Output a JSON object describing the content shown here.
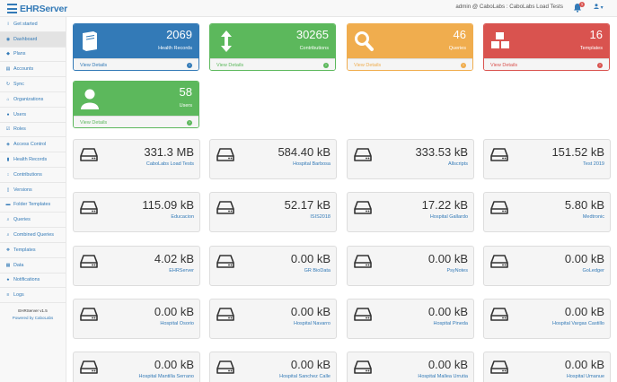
{
  "app": {
    "title": "EHRServer",
    "user_info": "admin @ CaboLabs : CaboLabs Load Tests",
    "notification_count": "1",
    "user_caret": "▾"
  },
  "sidebar": {
    "items": [
      {
        "label": "Get started",
        "icon": "info-icon"
      },
      {
        "label": "Dashboard",
        "icon": "dashboard-icon"
      },
      {
        "label": "Plans",
        "icon": "plans-icon"
      },
      {
        "label": "Accounts",
        "icon": "accounts-icon"
      },
      {
        "label": "Sync",
        "icon": "sync-icon"
      },
      {
        "label": "Organizations",
        "icon": "organizations-icon"
      },
      {
        "label": "Users",
        "icon": "user-icon"
      },
      {
        "label": "Roles",
        "icon": "roles-icon"
      },
      {
        "label": "Access Control",
        "icon": "shield-icon"
      },
      {
        "label": "Health Records",
        "icon": "health-records-icon"
      },
      {
        "label": "Contributions",
        "icon": "contributions-icon"
      },
      {
        "label": "Versions",
        "icon": "versions-icon"
      },
      {
        "label": "Folder Templates",
        "icon": "folder-icon"
      },
      {
        "label": "Queries",
        "icon": "search-icon"
      },
      {
        "label": "Combined Queries",
        "icon": "search-icon"
      },
      {
        "label": "Templates",
        "icon": "templates-icon"
      },
      {
        "label": "Data",
        "icon": "data-icon"
      },
      {
        "label": "Notifications",
        "icon": "bell-icon"
      },
      {
        "label": "Logs",
        "icon": "logs-icon"
      }
    ],
    "version": "EHRServer v1.5",
    "powered_by": "Powered by CaboLabs"
  },
  "panels": [
    {
      "count": "2069",
      "label": "Health Records",
      "link": "View Details",
      "color": "#337ab7",
      "icon": "book-icon"
    },
    {
      "count": "30265",
      "label": "Contributions",
      "link": "View Details",
      "color": "#5cb85c",
      "icon": "arrows-vertical-icon"
    },
    {
      "count": "46",
      "label": "Queries",
      "link": "View Details",
      "color": "#f0ad4e",
      "icon": "search-icon"
    },
    {
      "count": "16",
      "label": "Templates",
      "link": "View Details",
      "color": "#d9534f",
      "icon": "cubes-icon"
    },
    {
      "count": "58",
      "label": "Users",
      "link": "View Details",
      "color": "#5cb85c",
      "icon": "user-icon"
    }
  ],
  "storage": [
    {
      "size": "331.3 MB",
      "name": "CaboLabs Load Tests"
    },
    {
      "size": "584.40 kB",
      "name": "Hospital Barbosa"
    },
    {
      "size": "333.53 kB",
      "name": "Allscripts"
    },
    {
      "size": "151.52 kB",
      "name": "Test 2019"
    },
    {
      "size": "115.09 kB",
      "name": "Educacion"
    },
    {
      "size": "52.17 kB",
      "name": "ISIS2018"
    },
    {
      "size": "17.22 kB",
      "name": "Hospital Gallardo"
    },
    {
      "size": "5.80 kB",
      "name": "Medtronic"
    },
    {
      "size": "4.02 kB",
      "name": "EHRServer"
    },
    {
      "size": "0.00 kB",
      "name": "GR BioData"
    },
    {
      "size": "0.00 kB",
      "name": "PsyNotes"
    },
    {
      "size": "0.00 kB",
      "name": "GoLedger"
    },
    {
      "size": "0.00 kB",
      "name": "Hospital Osorio"
    },
    {
      "size": "0.00 kB",
      "name": "Hospital Navarro"
    },
    {
      "size": "0.00 kB",
      "name": "Hospital Pineda"
    },
    {
      "size": "0.00 kB",
      "name": "Hospital Vargas Castillo"
    },
    {
      "size": "0.00 kB",
      "name": "Hospital Mantilla Serrano"
    },
    {
      "size": "0.00 kB",
      "name": "Hospital Sanchez Calle"
    },
    {
      "size": "0.00 kB",
      "name": "Hospital Mallea Urrutia"
    },
    {
      "size": "0.00 kB",
      "name": "Hospital Umanue"
    }
  ]
}
